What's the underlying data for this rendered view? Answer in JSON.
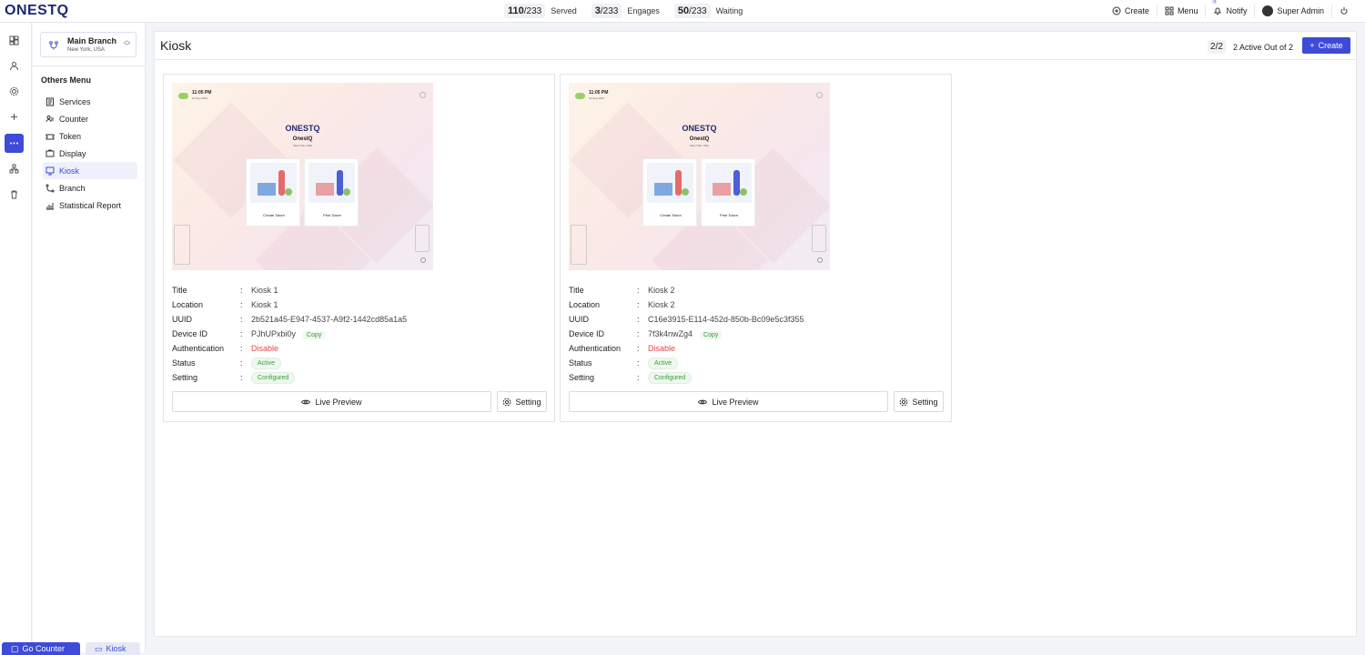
{
  "app": {
    "logo": "ONESTQ"
  },
  "stats": [
    {
      "num": "110",
      "total": "233",
      "label": "Served"
    },
    {
      "num": "3",
      "total": "233",
      "label": "Engages"
    },
    {
      "num": "50",
      "total": "233",
      "label": "Waiting"
    }
  ],
  "topnav": {
    "create": "Create",
    "menu": "Menu",
    "notify": "Notify",
    "notify_badge": "0",
    "user": "Super Admin"
  },
  "branch": {
    "name": "Main Branch",
    "location": "New York, USA"
  },
  "others_menu_title": "Others Menu",
  "menu_items": [
    {
      "label": "Services",
      "icon": "services-icon"
    },
    {
      "label": "Counter",
      "icon": "counter-icon"
    },
    {
      "label": "Token",
      "icon": "token-icon"
    },
    {
      "label": "Display",
      "icon": "display-icon"
    },
    {
      "label": "Kiosk",
      "icon": "kiosk-icon",
      "active": true
    },
    {
      "label": "Branch",
      "icon": "branch-icon"
    },
    {
      "label": "Statistical Report",
      "icon": "report-icon"
    }
  ],
  "page": {
    "title": "Kiosk",
    "count_num": "2",
    "count_total": "2",
    "count_text": "2 Active Out of 2",
    "create_label": "Create"
  },
  "field_labels": {
    "title": "Title",
    "location": "Location",
    "uuid": "UUID",
    "device_id": "Device ID",
    "authentication": "Authentication",
    "status": "Status",
    "setting": "Setting",
    "sep": ":"
  },
  "kiosks": [
    {
      "title": "Kiosk 1",
      "location": "Kiosk 1",
      "uuid": "2b521a45-E947-4537-A9f2-1442cd85a1a5",
      "device_id": "PJhUPxbi0y",
      "copy": "Copy",
      "authentication": "Disable",
      "status": "Active",
      "setting": "Configured",
      "live_preview": "Live Preview",
      "setting_button": "Setting",
      "preview": {
        "time": "11:05 PM",
        "date": "16 Sep 2024",
        "logo": "ONESTQ",
        "name": "OnestQ",
        "loc": "New York, USA",
        "tile1": "Create Token",
        "tile2": "Print Token"
      }
    },
    {
      "title": "Kiosk 2",
      "location": "Kiosk 2",
      "uuid": "C16e3915-E114-452d-850b-Bc09e5c3f355",
      "device_id": "7f3k4nwZg4",
      "copy": "Copy",
      "authentication": "Disable",
      "status": "Active",
      "setting": "Configured",
      "live_preview": "Live Preview",
      "setting_button": "Setting",
      "preview": {
        "time": "11:05 PM",
        "date": "16 Sep 2024",
        "logo": "ONESTQ",
        "name": "OnestQ",
        "loc": "New York, USA",
        "tile1": "Create Token",
        "tile2": "Print Token"
      }
    }
  ],
  "bottom": {
    "go_counter": "Go Counter",
    "kiosk": "Kiosk"
  },
  "colors": {
    "accent": "#3d4bd8",
    "danger": "#e14747",
    "success": "#3a9a3a"
  }
}
